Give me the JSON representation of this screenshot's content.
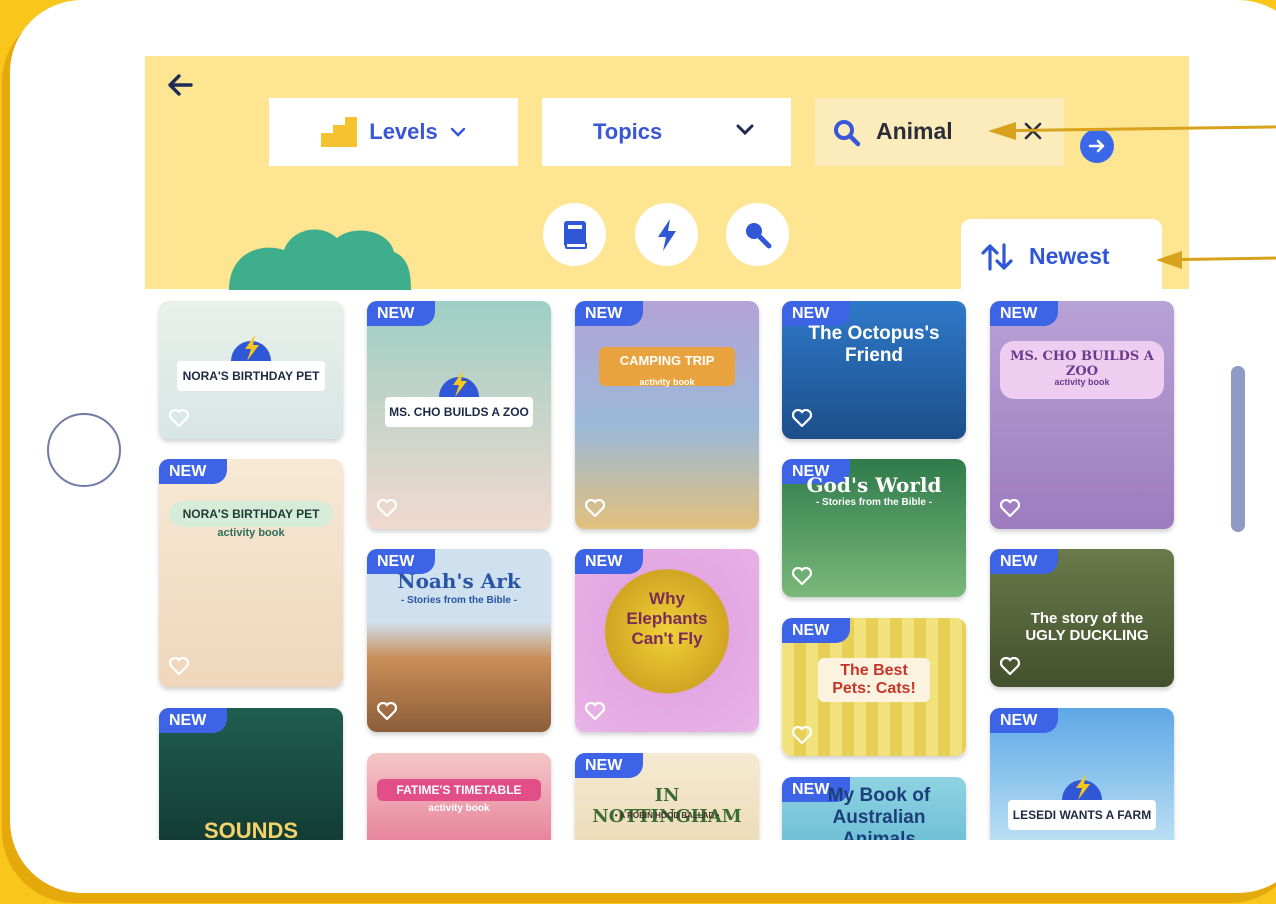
{
  "nav": {
    "back_icon": "arrow-left-icon"
  },
  "filters": {
    "levels_label": "Levels",
    "topics_label": "Topics",
    "search_value": "Animal"
  },
  "sort": {
    "label": "Newest"
  },
  "badge_text": "NEW",
  "books": [
    {
      "title": "NORA'S BIRTHDAY PET",
      "new": false
    },
    {
      "title": "NORA'S BIRTHDAY PET",
      "subtitle": "activity book",
      "new": true
    },
    {
      "title": "SOUNDS",
      "new": true
    },
    {
      "title": "MS. CHO BUILDS A ZOO",
      "new": true
    },
    {
      "title": "Noah's Ark",
      "subtitle": "- Stories from the Bible -",
      "new": true
    },
    {
      "title": "FATIME'S TIMETABLE",
      "subtitle": "activity book",
      "new": false
    },
    {
      "title": "CAMPING TRIP",
      "subtitle": "activity book",
      "new": true
    },
    {
      "title": "Why Elephants Can't Fly",
      "new": true
    },
    {
      "title": "IN NOTTINGHAM",
      "subtitle": "• A ROBIN HOOD BALLAD •",
      "new": true
    },
    {
      "title": "The Octopus's Friend",
      "new": true
    },
    {
      "title": "God's World",
      "subtitle": "- Stories from the Bible -",
      "new": true
    },
    {
      "title": "The Best Pets: Cats!",
      "new": true
    },
    {
      "title": "My Book of Australian Animals",
      "new": true
    },
    {
      "title": "MS. CHO BUILDS A ZOO",
      "subtitle": "activity book",
      "new": true
    },
    {
      "title": "The story of the UGLY DUCKLING",
      "new": true
    },
    {
      "title": "LESEDI WANTS A FARM",
      "new": true
    }
  ],
  "colors": {
    "accent": "#3a56d8",
    "band": "#fee592",
    "frame": "#f9c61c",
    "badge": "#3d63e6"
  }
}
